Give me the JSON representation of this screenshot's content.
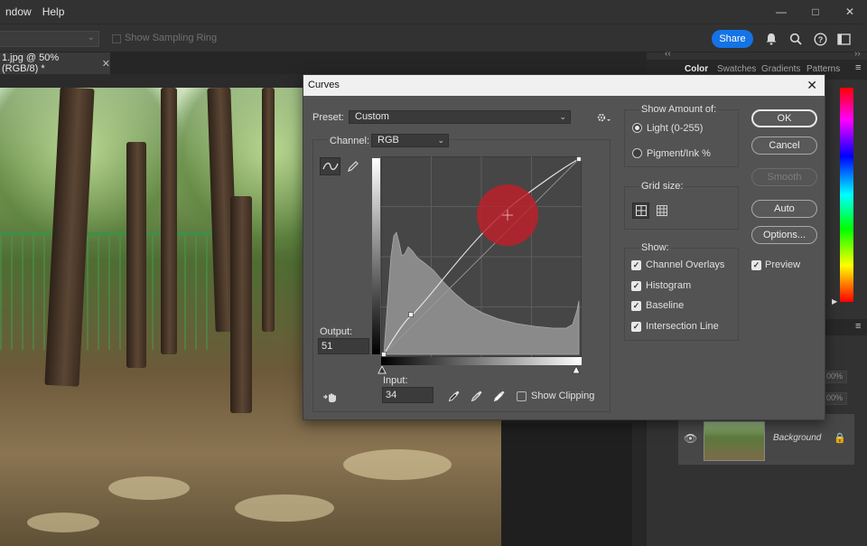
{
  "menu": {
    "items": [
      "ndow",
      "Help"
    ]
  },
  "window_controls": {
    "minimize": "—",
    "maximize": "□",
    "close": "✕"
  },
  "options_bar": {
    "sampling_ring_label": "Show Sampling Ring",
    "share_label": "Share"
  },
  "document": {
    "tab_title": "1.jpg @ 50% (RGB/8) *",
    "close": "✕"
  },
  "panels": {
    "tabs": [
      "Color",
      "Swatches",
      "Gradients",
      "Patterns"
    ],
    "active_tab": "Color",
    "collapse_left": "‹‹",
    "collapse_right": "››",
    "opacity_value": "00%",
    "fill_value": "00%",
    "layer": {
      "name": "Background"
    }
  },
  "curves": {
    "title": "Curves",
    "close": "✕",
    "preset_label": "Preset:",
    "preset_value": "Custom",
    "channel_label": "Channel:",
    "channel_value": "RGB",
    "output_label": "Output:",
    "output_value": "51",
    "input_label": "Input:",
    "input_value": "34",
    "show_clipping_label": "Show Clipping",
    "show_clipping_checked": false,
    "show_amount": {
      "title": "Show Amount of:",
      "light_label": "Light  (0-255)",
      "pigment_label": "Pigment/Ink %",
      "selected": "light"
    },
    "grid_size_title": "Grid size:",
    "show": {
      "title": "Show:",
      "options": [
        {
          "label": "Channel Overlays",
          "checked": true
        },
        {
          "label": "Histogram",
          "checked": true
        },
        {
          "label": "Baseline",
          "checked": true
        },
        {
          "label": "Intersection Line",
          "checked": true
        }
      ]
    },
    "buttons": {
      "ok": "OK",
      "cancel": "Cancel",
      "smooth": "Smooth",
      "auto": "Auto",
      "options": "Options..."
    },
    "preview_label": "Preview",
    "preview_checked": true,
    "accent_colors": {
      "cursor_highlight": "#c0202a",
      "share_blue": "#1473e6"
    }
  }
}
